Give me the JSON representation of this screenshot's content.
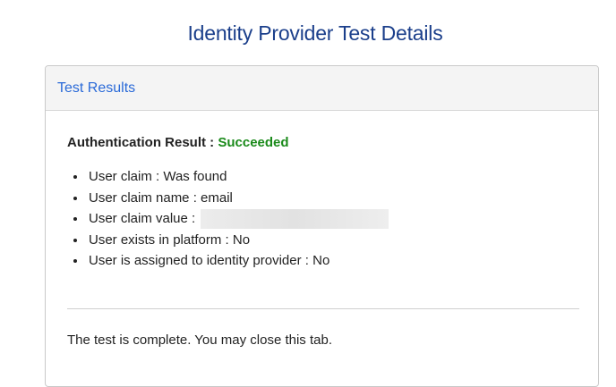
{
  "page": {
    "title": "Identity Provider Test Details"
  },
  "panel": {
    "title": "Test Results",
    "auth_label": "Authentication Result : ",
    "auth_status": "Succeeded",
    "claims": [
      "User claim : Was found",
      "User claim name : email",
      "User claim value :",
      "User exists in platform : No",
      "User is assigned to identity provider : No"
    ],
    "complete_message": "The test is complete. You may close this tab."
  }
}
